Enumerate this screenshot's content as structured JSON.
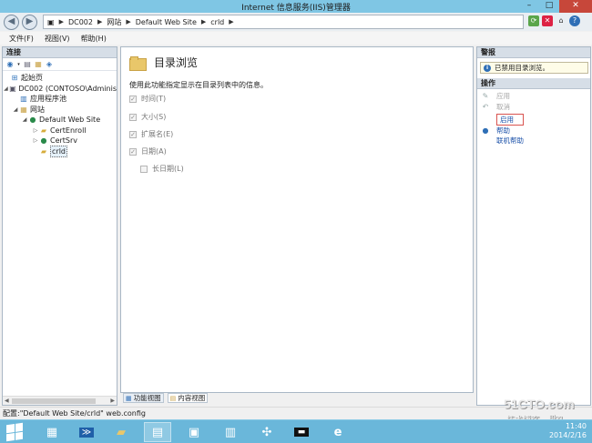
{
  "window": {
    "title": "Internet 信息服务(IIS)管理器"
  },
  "address": {
    "segments": [
      "DC002",
      "网站",
      "Default Web Site",
      "crld"
    ]
  },
  "menu": {
    "items": [
      "文件(F)",
      "视图(V)",
      "帮助(H)"
    ]
  },
  "connections": {
    "header": "连接",
    "tree": [
      {
        "label": "起始页",
        "icon": "start-page-icon"
      },
      {
        "label": "DC002 (CONTOSO\\Adminis",
        "icon": "server-icon"
      },
      {
        "label": "应用程序池",
        "icon": "app-pool-icon"
      },
      {
        "label": "网站",
        "icon": "sites-folder-icon"
      },
      {
        "label": "Default Web Site",
        "icon": "globe-icon"
      },
      {
        "label": "CertEnroll",
        "icon": "folder-icon"
      },
      {
        "label": "CertSrv",
        "icon": "folder-icon"
      },
      {
        "label": "crld",
        "icon": "folder-icon"
      }
    ]
  },
  "feature": {
    "title": "目录浏览",
    "description": "使用此功能指定显示在目录列表中的信息。",
    "options": [
      {
        "label": "时间(T)",
        "checked": true
      },
      {
        "label": "大小(S)",
        "checked": true
      },
      {
        "label": "扩展名(E)",
        "checked": true
      },
      {
        "label": "日期(A)",
        "checked": true
      },
      {
        "label": "长日期(L)",
        "checked": false
      }
    ]
  },
  "view_tabs": {
    "features": "功能视图",
    "content": "内容视图"
  },
  "alerts": {
    "header": "警报",
    "message": "已禁用目录浏览。"
  },
  "actions": {
    "header": "操作",
    "apply": "应用",
    "cancel": "取消",
    "enable": "启用",
    "help": "帮助",
    "online_help": "联机帮助"
  },
  "status": {
    "text": "配置:\"Default Web Site/crld\" web.config"
  },
  "taskbar": {
    "time": "11:40",
    "date": "2014/2/16"
  },
  "watermark": {
    "site": "51CTO.com",
    "blog": "技术博客",
    "tag": "Blog"
  }
}
